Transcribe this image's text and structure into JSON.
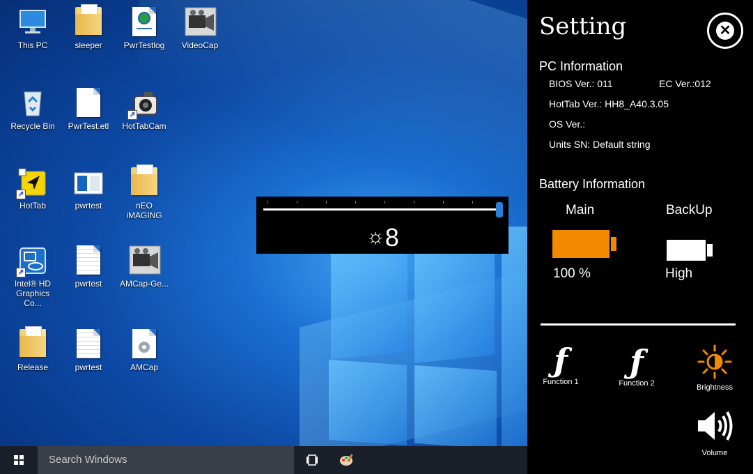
{
  "desktop": {
    "icons": [
      {
        "label": "This PC",
        "icon": "monitor-icon"
      },
      {
        "label": "sleeper",
        "icon": "folder-icon"
      },
      {
        "label": "PwrTestlog",
        "icon": "web-document-icon"
      },
      {
        "label": "VideoCap",
        "icon": "camera-app-icon"
      },
      {
        "label": "Recycle Bin",
        "icon": "recycle-bin-icon"
      },
      {
        "label": "PwrTest.etl",
        "icon": "document-icon"
      },
      {
        "label": "HotTabCam",
        "icon": "camera-icon"
      },
      {
        "label": "HotTab",
        "icon": "hottab-app-icon"
      },
      {
        "label": "pwrtest",
        "icon": "window-app-icon"
      },
      {
        "label": "nEO\niMAGING",
        "icon": "folder-icon"
      },
      {
        "label": "Intel® HD\nGraphics Co...",
        "icon": "intel-graphics-icon"
      },
      {
        "label": "pwrtest",
        "icon": "text-document-icon"
      },
      {
        "label": "AMCap-Ge...",
        "icon": "camera-app-icon"
      },
      {
        "label": "Release",
        "icon": "folder-icon"
      },
      {
        "label": "pwrtest",
        "icon": "text-document-icon"
      },
      {
        "label": "AMCap",
        "icon": "settings-document-icon"
      }
    ]
  },
  "taskbar": {
    "search_placeholder": "Search Windows"
  },
  "brightness_osd": {
    "value": "8",
    "level": 1.0
  },
  "settings_panel": {
    "title": "Setting",
    "pc_info": {
      "heading": "PC Information",
      "bios": "BIOS Ver.: 011",
      "ec": "EC Ver.:012",
      "hottab": "HotTab Ver.: HH8_A40.3.05",
      "os": "OS Ver.:",
      "sn": "Units SN: Default string"
    },
    "battery_info": {
      "heading": "Battery Information",
      "main_label": "Main",
      "main_value": "100 %",
      "main_level": 1.0,
      "main_color": "#f28a00",
      "backup_label": "BackUp",
      "backup_value": "High",
      "backup_level": 1.0,
      "backup_color": "#ffffff"
    },
    "buttons": {
      "function1": "Function 1",
      "function2": "Function 2",
      "brightness": "Brightness",
      "volume": "Volume",
      "brightness_color": "#f28a00"
    }
  }
}
